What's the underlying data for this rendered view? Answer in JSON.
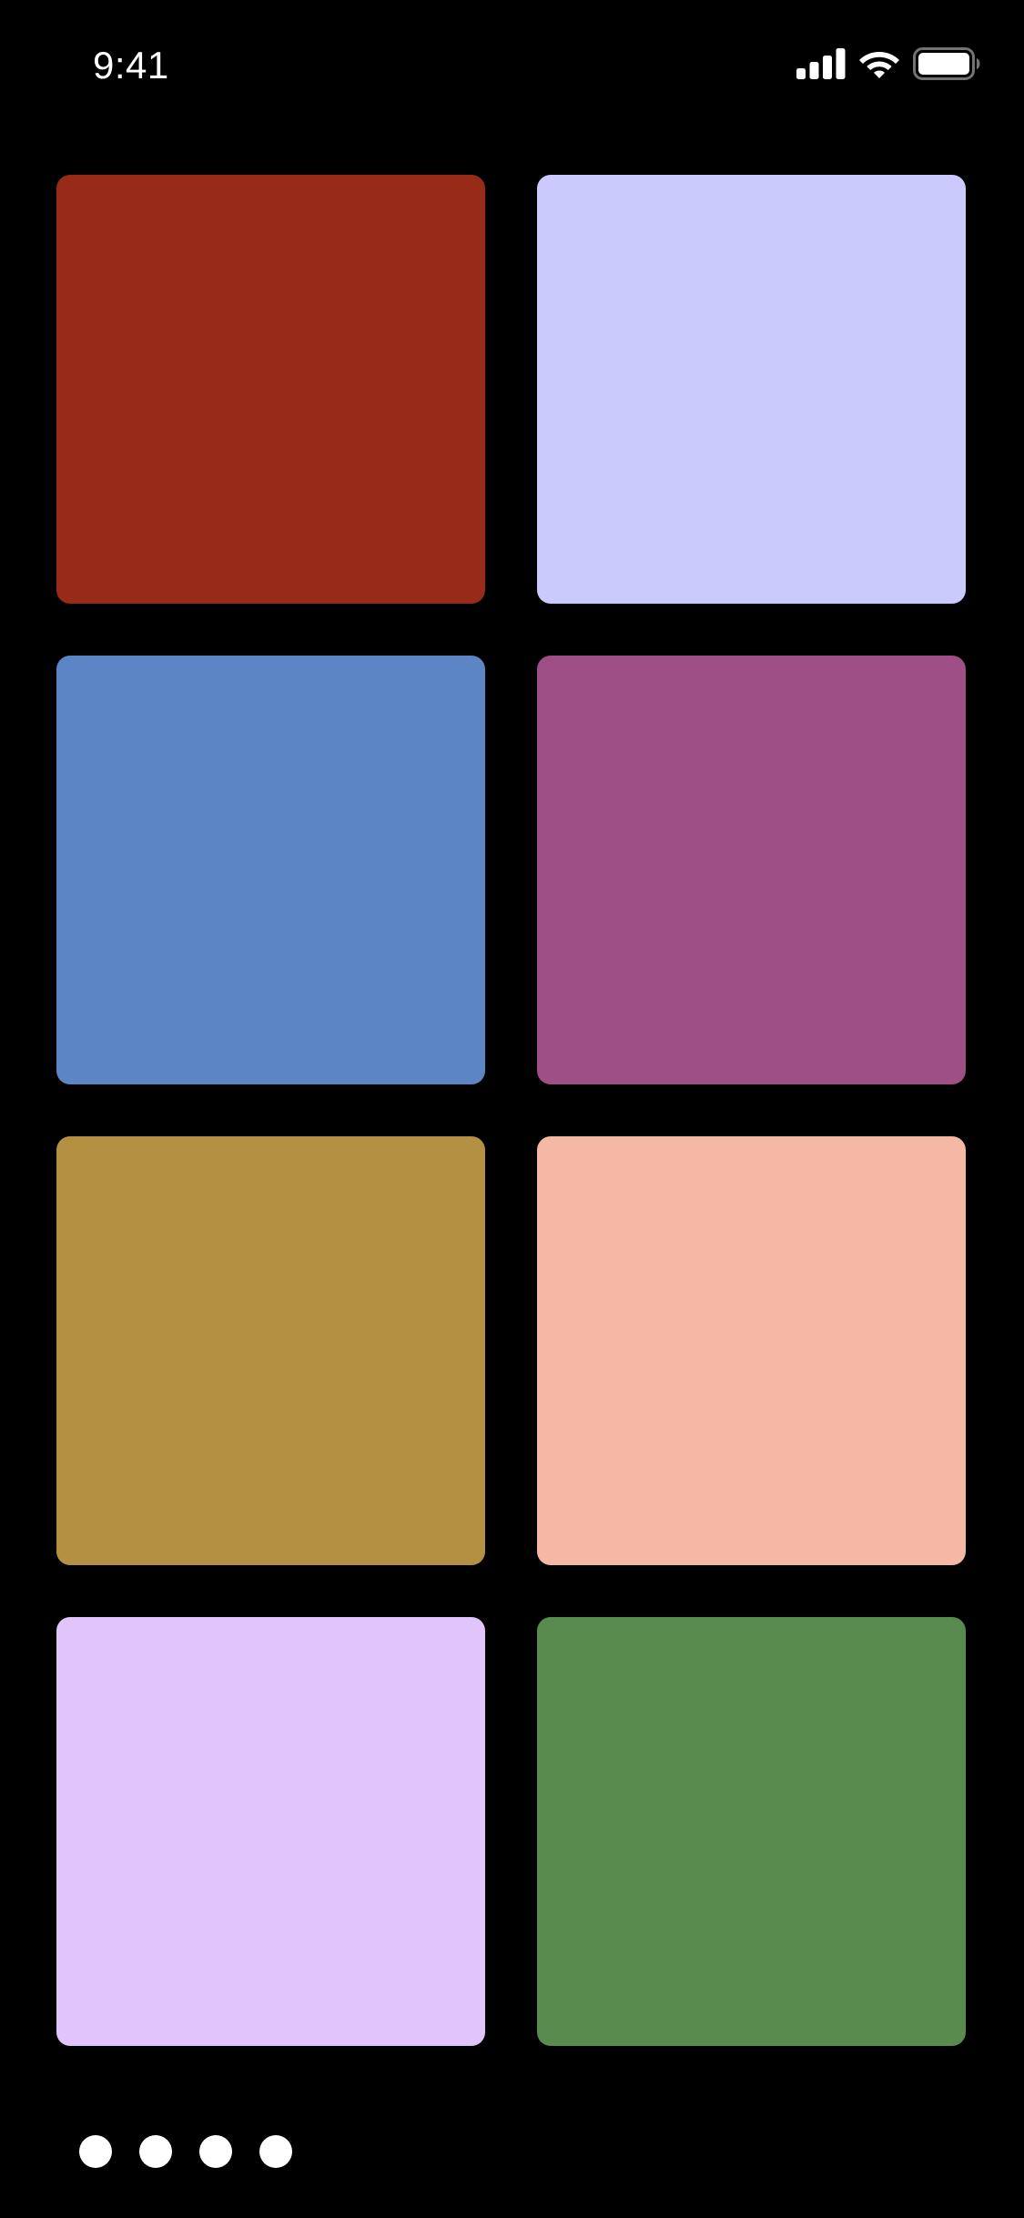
{
  "status_bar": {
    "time": "9:41",
    "icons": [
      "cellular-signal-icon",
      "wifi-icon",
      "battery-icon"
    ],
    "icon_color": "#ffffff"
  },
  "background_color": "#000000",
  "tiles": [
    {
      "color": "#972B17"
    },
    {
      "color": "#CACAFC"
    },
    {
      "color": "#5B85C4"
    },
    {
      "color": "#9E4F86"
    },
    {
      "color": "#B49042"
    },
    {
      "color": "#F4B8A4"
    },
    {
      "color": "#E1C4FA"
    },
    {
      "color": "#598B4E"
    }
  ],
  "page_indicator": {
    "count": 4,
    "dot_color": "#ffffff"
  }
}
